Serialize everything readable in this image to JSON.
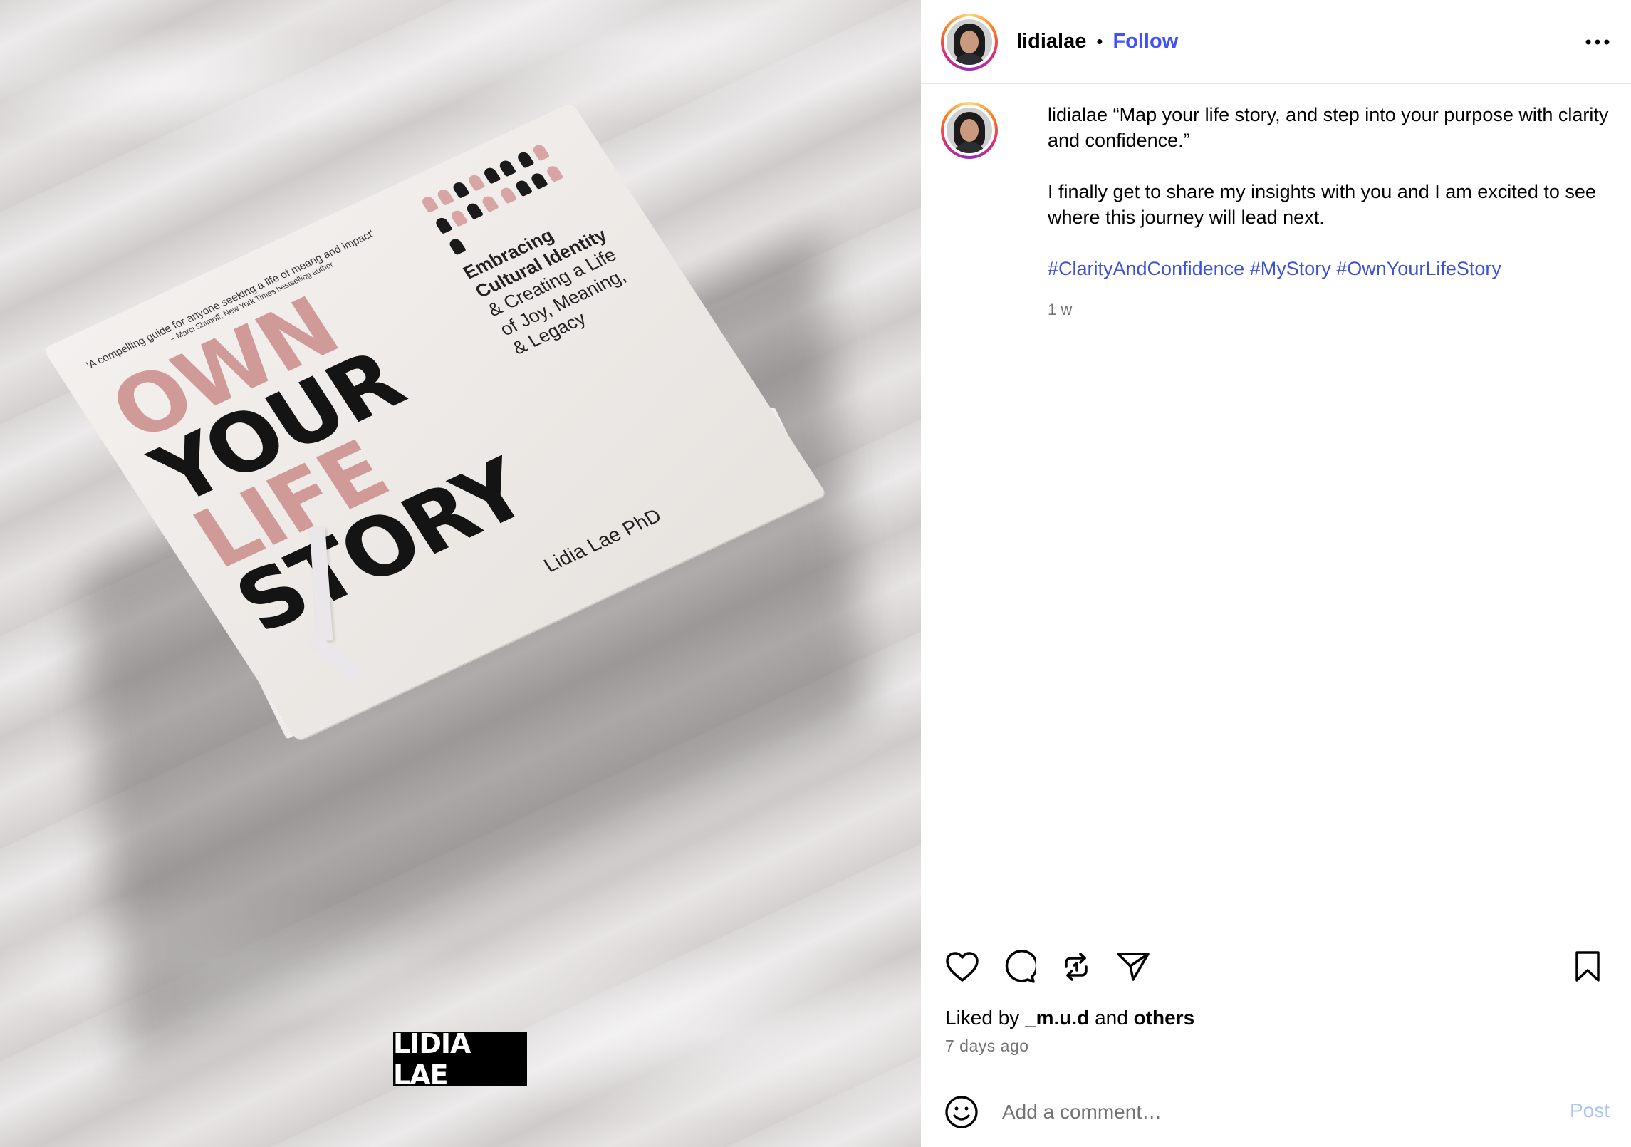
{
  "post": {
    "username": "lidialae",
    "follow_label": "Follow",
    "header_separator": "•"
  },
  "media": {
    "cover_quote": "'A compelling guide for anyone seeking a life of meang and impact'",
    "cover_quote_attribution": "– Marci Shimoff, New York Times bestselling author",
    "cover_title_line1": "OWN",
    "cover_title_line2": "YOUR",
    "cover_title_line3": "LIFE",
    "cover_title_line4": "STORY",
    "cover_subtitle_bold1": "Embracing",
    "cover_subtitle_bold2": "Cultural Identity",
    "cover_subtitle_rest1": "& Creating a Life",
    "cover_subtitle_rest2": "of Joy, Meaning,",
    "cover_subtitle_rest3": "& Legacy",
    "cover_author": "Lidia Lae PhD",
    "watermark_text": "LIDIA LAE"
  },
  "caption": {
    "username": "lidialae",
    "paragraph1": "“Map your life story, and step into your purpose with clarity and confidence.”",
    "paragraph2": "I finally get to share my insights with you and I am excited to see where this journey will lead next.",
    "hashtags": [
      "#ClarityAndConfidence",
      "#MyStory",
      "#OwnYourLifeStory"
    ],
    "relative_time": "1 w"
  },
  "actions": {
    "liked_by_prefix": "Liked by",
    "liked_by_user": "_m.u.d",
    "liked_by_and": "and",
    "liked_by_others": "others",
    "posted_ago": "7 days ago"
  },
  "comment": {
    "placeholder": "Add a comment…",
    "post_label": "Post"
  },
  "colors": {
    "link_blue": "#4150f7",
    "hashtag_blue": "#3d52d5",
    "post_disabled": "#a9c6f5",
    "secondary_text": "#737373"
  },
  "icons": [
    "more-options-icon",
    "heart-icon",
    "comment-icon",
    "repost-icon",
    "share-icon",
    "bookmark-icon",
    "emoji-icon"
  ]
}
